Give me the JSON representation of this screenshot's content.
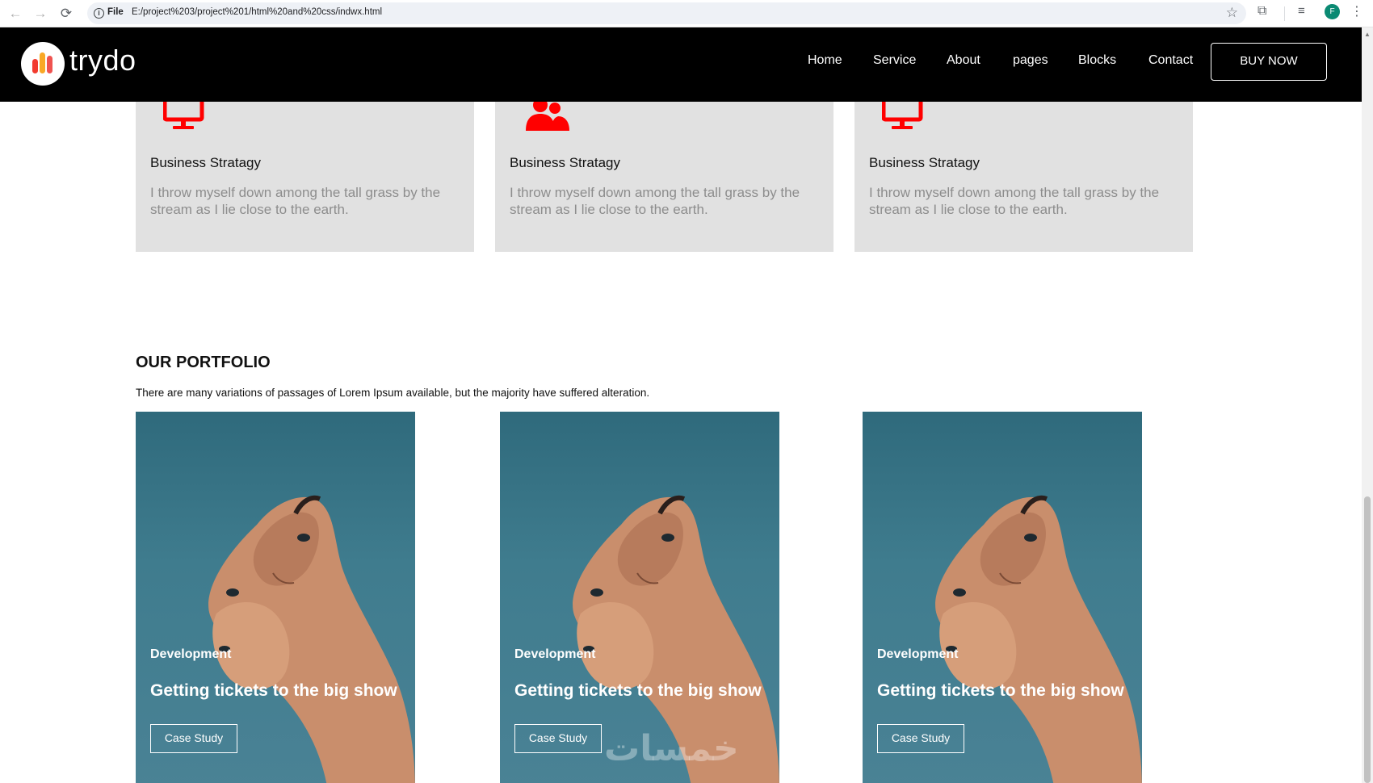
{
  "browser": {
    "back_icon": "←",
    "forward_icon": "→",
    "reload_icon": "⟳",
    "info_icon": "i",
    "file_label": "File",
    "url": "E:/project%203/project%201/html%20and%20css/indwx.html",
    "star_icon": "☆",
    "extension_icon": "⧉",
    "media_icon": "≡",
    "profile_initial": "F",
    "menu_icon": "⋮"
  },
  "header": {
    "logo_text": "trydo",
    "nav": [
      "Home",
      "Service",
      "About",
      "pages",
      "Blocks",
      "Contact"
    ],
    "buy_label": "BUY NOW"
  },
  "services": {
    "items": [
      {
        "icon": "monitor-icon",
        "title": "Business Stratagy",
        "description": "I throw myself down among the tall grass by the stream as I lie close to the earth."
      },
      {
        "icon": "users-icon",
        "title": "Business Stratagy",
        "description": "I throw myself down among the tall grass by the stream as I lie close to the earth."
      },
      {
        "icon": "monitor-icon",
        "title": "Business Stratagy",
        "description": "I throw myself down among the tall grass by the stream as I lie close to the earth."
      }
    ],
    "icon_color": "#ff0000"
  },
  "portfolio": {
    "heading": "OUR PORTFOLIO",
    "subtitle": "There are many variations of passages of Lorem Ipsum available, but the majority have suffered alteration.",
    "cards": [
      {
        "category": "Development",
        "title": "Getting tickets to the big show",
        "button": "Case Study"
      },
      {
        "category": "Development",
        "title": "Getting tickets to the big show",
        "button": "Case Study"
      },
      {
        "category": "Development",
        "title": "Getting tickets to the big show",
        "button": "Case Study"
      }
    ]
  },
  "watermark": "خمسات"
}
